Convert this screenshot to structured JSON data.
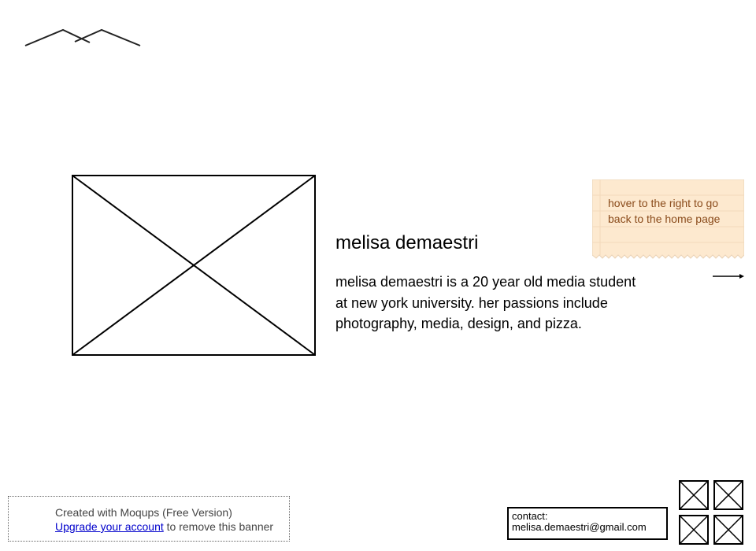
{
  "profile": {
    "name": "melisa demaestri",
    "bio": "melisa demaestri is a 20 year old media student at new york university. her passions include photography, media, design, and pizza."
  },
  "sticky_note": {
    "text": "hover to the right to go back to the home page"
  },
  "banner": {
    "created_text": "Created with Moqups (Free Version)",
    "upgrade_link": "Upgrade your account",
    "remove_text": " to remove this banner"
  },
  "contact": {
    "label": "contact:",
    "email": "melisa.demaestri@gmail.com"
  },
  "icons": {
    "logo": "mountain-logo-icon",
    "main_image": "image-placeholder-icon",
    "arrow": "arrow-right-icon",
    "social": [
      "social-icon-1",
      "social-icon-2",
      "social-icon-3",
      "social-icon-4"
    ]
  },
  "colors": {
    "sticky_fill": "#fde9cf",
    "sticky_text": "#8a4b1b",
    "link": "#0000cc"
  }
}
